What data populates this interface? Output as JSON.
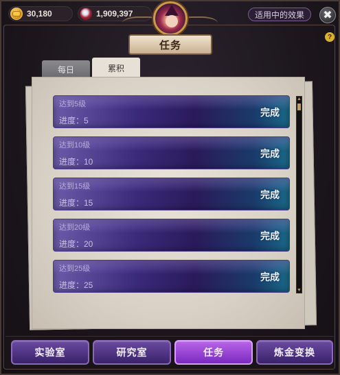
{
  "currency": {
    "gold": "30,180",
    "gems": "1,909,397",
    "gold_icon": "gold-coin-icon",
    "gem_icon": "red-gem-icon"
  },
  "header": {
    "effects_label": "适用中的效果",
    "title": "任务",
    "close_glyph": "✖",
    "help_glyph": "?"
  },
  "tabs": [
    {
      "label": "每日",
      "active": false
    },
    {
      "label": "累积",
      "active": true
    }
  ],
  "quests": [
    {
      "name": "达到5级",
      "progress": "进度：5",
      "status": "完成"
    },
    {
      "name": "达到10级",
      "progress": "进度：10",
      "status": "完成"
    },
    {
      "name": "达到15级",
      "progress": "进度：15",
      "status": "完成"
    },
    {
      "name": "达到20级",
      "progress": "进度：20",
      "status": "完成"
    },
    {
      "name": "达到25级",
      "progress": "进度：25",
      "status": "完成"
    }
  ],
  "scrollbar": {
    "up": "▲",
    "down": "▼"
  },
  "nav": [
    {
      "label": "实验室",
      "active": false
    },
    {
      "label": "研究室",
      "active": false
    },
    {
      "label": "任务",
      "active": true
    },
    {
      "label": "炼金变换",
      "active": false
    }
  ],
  "colors": {
    "nav_active": "#9a46d8",
    "nav_inactive": "#52347e",
    "quest_start": "#6a5aa8",
    "quest_end": "#1a6a8a"
  }
}
